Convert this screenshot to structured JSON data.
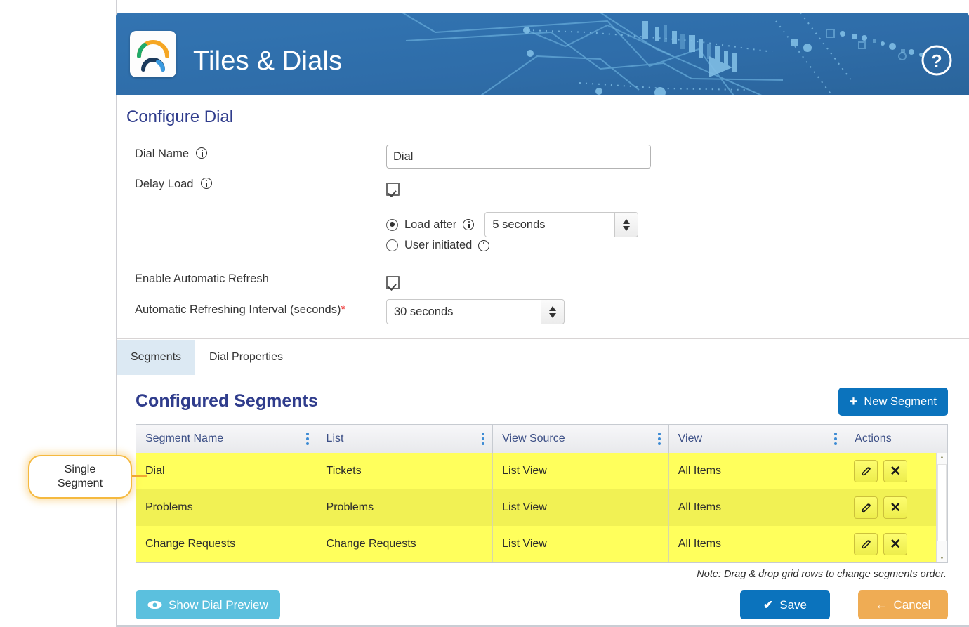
{
  "app": {
    "title": "Tiles & Dials",
    "logo_icon": "dial-gauge-logo",
    "help_icon": "help-circle-icon",
    "header_color": "#3071b0"
  },
  "configure": {
    "title": "Configure Dial",
    "dial_name": {
      "label": "Dial Name",
      "info_icon": "info-icon",
      "value": "Dial",
      "placeholder": ""
    },
    "delay_load": {
      "label": "Delay Load",
      "info_icon": "info-icon",
      "checked": true,
      "options": [
        {
          "label": "Load after",
          "info_icon": "info-icon",
          "selected": true,
          "value": "5 seconds"
        },
        {
          "label": "User initiated",
          "info_icon": "info-icon",
          "selected": false
        }
      ]
    },
    "auto_refresh": {
      "label": "Enable Automatic Refresh",
      "checked": true
    },
    "refresh_interval": {
      "label": "Automatic Refreshing Interval (seconds)",
      "required_marker": "*",
      "value": "30 seconds"
    }
  },
  "tabs": [
    {
      "label": "Segments",
      "active": true
    },
    {
      "label": "Dial Properties",
      "active": false
    }
  ],
  "segments": {
    "title": "Configured Segments",
    "new_button": {
      "label": "New Segment",
      "icon": "plus-icon"
    },
    "columns": [
      "Segment Name",
      "List",
      "View Source",
      "View",
      "Actions"
    ],
    "rows": [
      {
        "segment_name": "Dial",
        "list": "Tickets",
        "view_source": "List View",
        "view": "All Items"
      },
      {
        "segment_name": "Problems",
        "list": "Problems",
        "view_source": "List View",
        "view": "All Items"
      },
      {
        "segment_name": "Change Requests",
        "list": "Change Requests",
        "view_source": "List View",
        "view": "All Items"
      }
    ],
    "row_actions": [
      {
        "name": "edit",
        "icon": "pencil-icon"
      },
      {
        "name": "delete",
        "icon": "close-x-icon"
      }
    ],
    "note": "Note: Drag & drop grid rows to change segments order."
  },
  "footer": {
    "preview": {
      "label": "Show Dial Preview",
      "icon": "eye-icon",
      "color": "#5bc0de"
    },
    "save": {
      "label": "Save",
      "icon": "check-icon",
      "color": "#0b73bd"
    },
    "cancel": {
      "label": "Cancel",
      "icon": "arrow-left-icon",
      "color": "#efac54"
    }
  },
  "annotation": {
    "callout_line1": "Single",
    "callout_line2": "Segment",
    "accent": "#f5b93f"
  }
}
